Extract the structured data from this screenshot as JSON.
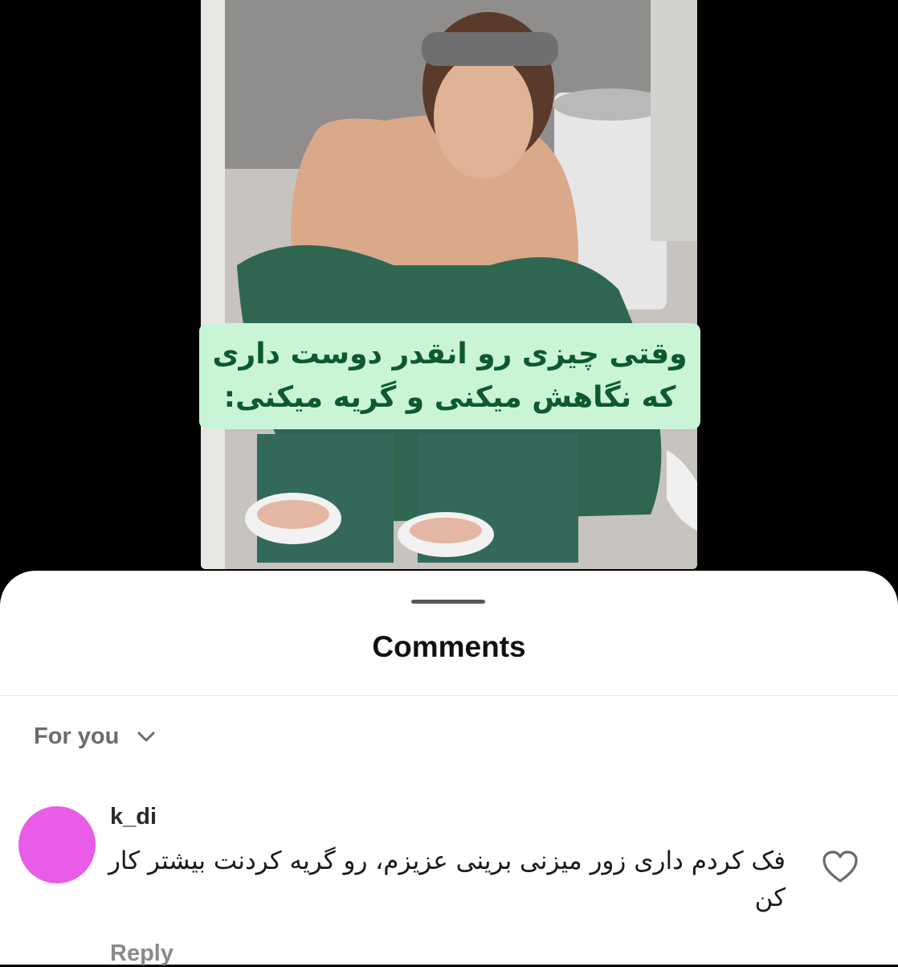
{
  "post": {
    "caption_lines": [
      "وقتی چیزی رو انقدر دوست داری",
      "که نگاهش میکنی و گریه میکنی:"
    ],
    "caption_bg": "#c9f5d6",
    "caption_color": "#0d5a2c"
  },
  "comments_sheet": {
    "title": "Comments",
    "sort_label": "For you",
    "sort_icon": "chevron-down-icon"
  },
  "comments": [
    {
      "username": "k_di",
      "avatar_color": "#e85ce8",
      "text": "فک کردم داری زور میزنی برینی عزیزم، رو گریه کردنت بیشتر کار کن",
      "reply_label": "Reply",
      "like_icon": "heart-outline-icon"
    }
  ]
}
